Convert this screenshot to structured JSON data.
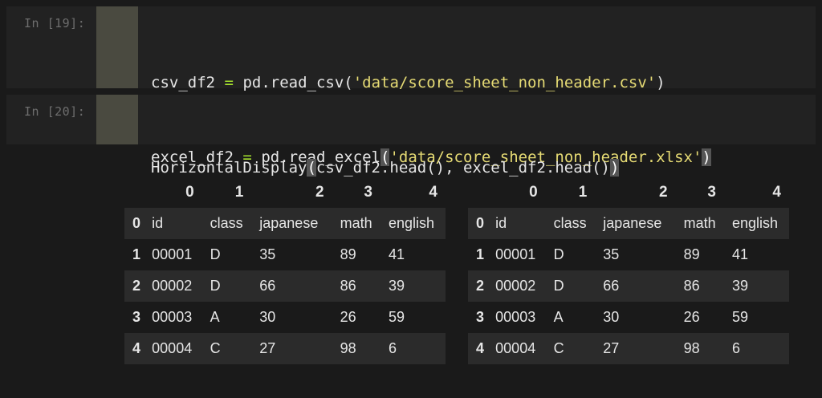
{
  "cells": [
    {
      "prompt": "In [19]:",
      "line1": {
        "var": "csv_df2",
        "op": "=",
        "call": "pd.read_csv(",
        "arg": "'data/score_sheet_non_header.csv'",
        "close": ")"
      },
      "line2": {
        "var": "excel_df2",
        "op": "=",
        "call": "pd.read_excel",
        "open": "(",
        "arg": "'data/score_sheet_non_header.xlsx'",
        "close": ")"
      }
    },
    {
      "prompt": "In [20]:",
      "line1": {
        "call": "HorizontalDisplay",
        "open": "(",
        "args": "csv_df2.head(), excel_df2.head()",
        "close": ")"
      }
    }
  ],
  "tables": [
    {
      "columns": [
        "",
        "0",
        "1",
        "2",
        "3",
        "4"
      ],
      "rows": [
        [
          "0",
          "id",
          "class",
          "japanese",
          "math",
          "english"
        ],
        [
          "1",
          "00001",
          "D",
          "35",
          "89",
          "41"
        ],
        [
          "2",
          "00002",
          "D",
          "66",
          "86",
          "39"
        ],
        [
          "3",
          "00003",
          "A",
          "30",
          "26",
          "59"
        ],
        [
          "4",
          "00004",
          "C",
          "27",
          "98",
          "6"
        ]
      ]
    },
    {
      "columns": [
        "",
        "0",
        "1",
        "2",
        "3",
        "4"
      ],
      "rows": [
        [
          "0",
          "id",
          "class",
          "japanese",
          "math",
          "english"
        ],
        [
          "1",
          "00001",
          "D",
          "35",
          "89",
          "41"
        ],
        [
          "2",
          "00002",
          "D",
          "66",
          "86",
          "39"
        ],
        [
          "3",
          "00003",
          "A",
          "30",
          "26",
          "59"
        ],
        [
          "4",
          "00004",
          "C",
          "27",
          "98",
          "6"
        ]
      ]
    }
  ],
  "colors": {
    "background": "#1a1a1a",
    "cell_bg": "#222222",
    "gutter": "#4a4a40",
    "keyword": "#a6e22e",
    "string": "#e6db74",
    "text": "#e6e6e6"
  }
}
